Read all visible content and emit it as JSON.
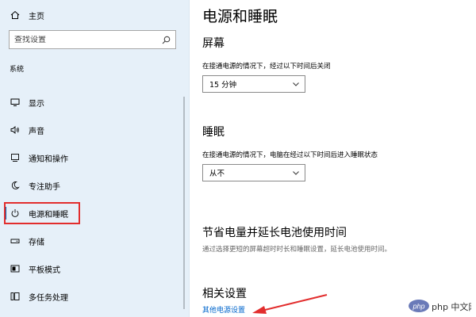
{
  "sidebar": {
    "home_label": "主页",
    "search": {
      "placeholder": "查找设置"
    },
    "section_label": "系统",
    "items": [
      {
        "label": "显示",
        "icon": "monitor-icon"
      },
      {
        "label": "声音",
        "icon": "speaker-icon"
      },
      {
        "label": "通知和操作",
        "icon": "notification-icon"
      },
      {
        "label": "专注助手",
        "icon": "moon-icon"
      },
      {
        "label": "电源和睡眠",
        "icon": "power-icon",
        "selected": true
      },
      {
        "label": "存储",
        "icon": "storage-icon"
      },
      {
        "label": "平板模式",
        "icon": "tablet-icon"
      },
      {
        "label": "多任务处理",
        "icon": "multitask-icon"
      }
    ]
  },
  "main": {
    "title": "电源和睡眠",
    "screen": {
      "heading": "屏幕",
      "desc": "在接通电源的情况下，经过以下时间后关闭",
      "value": "15 分钟"
    },
    "sleep": {
      "heading": "睡眠",
      "desc": "在接通电源的情况下，电脑在经过以下时间后进入睡眠状态",
      "value": "从不"
    },
    "battery": {
      "heading": "节省电量并延长电池使用时间",
      "desc": "通过选择更短的屏幕超时时长和睡眠设置，延长电池使用时间。"
    },
    "related": {
      "heading": "相关设置",
      "link": "其他电源设置"
    }
  },
  "watermark": {
    "text": "php 中文网"
  },
  "colors": {
    "sidebar_bg": "#e6f0f9",
    "accent": "#0063b1",
    "link": "#0066cc",
    "annotation_red": "#e22d2d"
  }
}
